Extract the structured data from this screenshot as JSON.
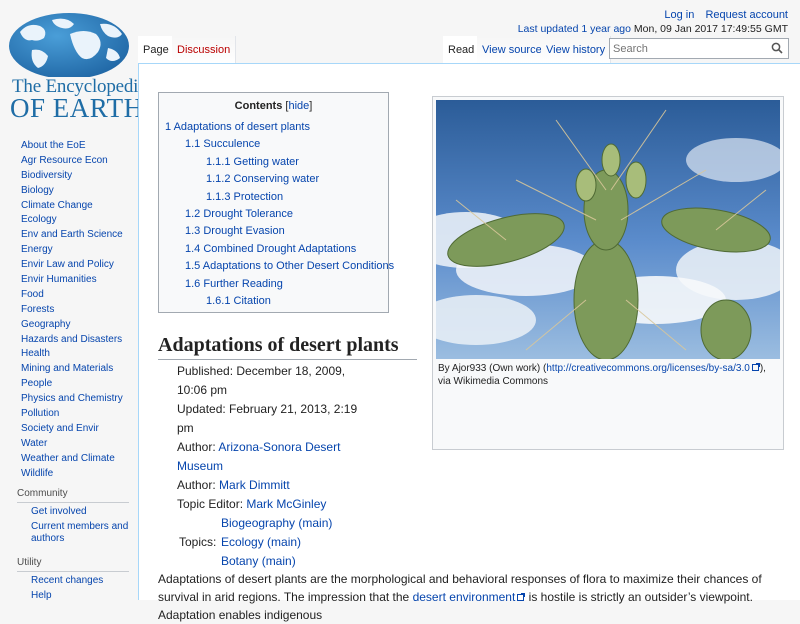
{
  "personal": {
    "login": "Log in",
    "request": "Request account",
    "updated_link": "Last updated 1 year ago",
    "updated_date": "Mon, 09 Jan 2017 17:49:55 GMT"
  },
  "logo": {
    "line1": "The Encyclopedia",
    "line2": "OF EARTH"
  },
  "sidebar": {
    "nav": [
      "About the EoE",
      "Agr Resource Econ",
      "Biodiversity",
      "Biology",
      "Climate Change",
      "Ecology",
      "Env and Earth Science",
      "Energy",
      "Envir Law and Policy",
      "Envir Humanities",
      "Food",
      "Forests",
      "Geography",
      "Hazards and Disasters",
      "Health",
      "Mining and Materials",
      "People",
      "Physics and Chemistry",
      "Pollution",
      "Society and Envir",
      "Water",
      "Weather and Climate",
      "Wildlife"
    ],
    "community_heading": "Community",
    "community": [
      "Get involved",
      "Current members and authors"
    ],
    "utility_heading": "Utility",
    "utility": [
      "Recent changes",
      "Help"
    ]
  },
  "tabs": {
    "page": "Page",
    "discussion": "Discussion",
    "read": "Read",
    "view_source": "View source",
    "view_history": "View history"
  },
  "search": {
    "placeholder": "Search"
  },
  "toc": {
    "title": "Contents",
    "hide": "hide",
    "items": [
      {
        "num": "1",
        "text": "Adaptations of desert plants",
        "level": 1
      },
      {
        "num": "1.1",
        "text": "Succulence",
        "level": 2
      },
      {
        "num": "1.1.1",
        "text": "Getting water",
        "level": 3
      },
      {
        "num": "1.1.2",
        "text": "Conserving water",
        "level": 3
      },
      {
        "num": "1.1.3",
        "text": "Protection",
        "level": 3
      },
      {
        "num": "1.2",
        "text": "Drought Tolerance",
        "level": 2
      },
      {
        "num": "1.3",
        "text": "Drought Evasion",
        "level": 2
      },
      {
        "num": "1.4",
        "text": "Combined Drought Adaptations",
        "level": 2
      },
      {
        "num": "1.5",
        "text": "Adaptations to Other Desert Conditions",
        "level": 2
      },
      {
        "num": "1.6",
        "text": "Further Reading",
        "level": 2
      },
      {
        "num": "1.6.1",
        "text": "Citation",
        "level": 3
      }
    ]
  },
  "figure": {
    "caption_pre": "By Ajor933 (Own work) (",
    "caption_link": "http://creativecommons.org/licenses/by-sa/3.0",
    "caption_post": "), via Wikimedia Commons"
  },
  "article": {
    "title": "Adaptations of desert plants",
    "published_label": "Published:",
    "published": "December 18, 2009, 10:06 pm",
    "updated_label": "Updated:",
    "updated": "February 21, 2013, 2:19 pm",
    "author_label": "Author:",
    "author1": "Arizona-Sonora Desert Museum",
    "author2": "Mark Dimmitt",
    "editor_label": "Topic Editor:",
    "editor": "Mark McGinley",
    "topics_label": "Topics:",
    "topics": [
      "Biogeography (main)",
      "Ecology (main)",
      "Botany (main)"
    ],
    "para_1": "Adaptations of desert plants are the morphological and behavioral responses of flora to maximize their chances of survival in arid regions. The impression that the ",
    "para_link": "desert environment",
    "para_2": " is hostile is strictly an outsider’s viewpoint. Adaptation enables indigenous"
  }
}
